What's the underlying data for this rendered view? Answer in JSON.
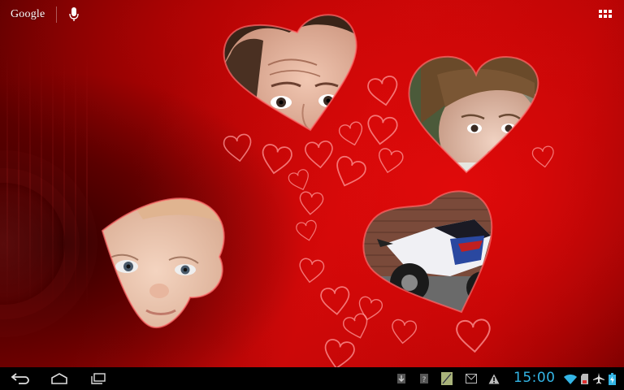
{
  "top_bar": {
    "search_logo_text": "Google",
    "voice_icon": "microphone-icon",
    "apps_icon": "all-apps-grid-icon"
  },
  "wallpaper": {
    "theme_color": "#c90808",
    "photos": [
      {
        "subject": "woman-forehead-eyes"
      },
      {
        "subject": "girl-with-lollipop"
      },
      {
        "subject": "baby-face"
      },
      {
        "subject": "motorcycle"
      }
    ]
  },
  "nav_bar": {
    "back_icon": "back-icon",
    "home_icon": "home-icon",
    "recents_icon": "recent-apps-icon"
  },
  "notifications": [
    {
      "icon": "download-icon"
    },
    {
      "icon": "unknown-app-icon"
    },
    {
      "icon": "image-app-icon"
    },
    {
      "icon": "gmail-icon"
    },
    {
      "icon": "warning-icon"
    }
  ],
  "status": {
    "time": "15:00",
    "wifi_icon": "wifi-icon",
    "sd_icon": "sd-card-icon",
    "airplane_icon": "airplane-icon",
    "battery_icon": "battery-charging-icon",
    "accent_color": "#33b5e5"
  }
}
